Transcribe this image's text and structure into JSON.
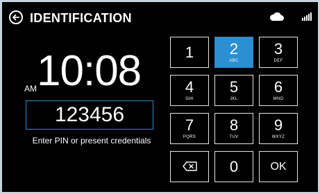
{
  "header": {
    "title": "IDENTIFICATION",
    "back_icon": "back-arrow-circle-icon",
    "status_icons": [
      "cloud-icon",
      "signal-strength-icon"
    ]
  },
  "clock": {
    "time": "10:08",
    "meridiem": "AM"
  },
  "pin": {
    "value": "123456"
  },
  "prompt": "Enter PIN or present credentials",
  "keypad": {
    "keys": [
      {
        "num": "1",
        "sub": ""
      },
      {
        "num": "2",
        "sub": "ABC"
      },
      {
        "num": "3",
        "sub": "DEF"
      },
      {
        "num": "4",
        "sub": "GHI"
      },
      {
        "num": "5",
        "sub": "JKL"
      },
      {
        "num": "6",
        "sub": "MNO"
      },
      {
        "num": "7",
        "sub": "PQRS"
      },
      {
        "num": "8",
        "sub": "TUV"
      },
      {
        "num": "9",
        "sub": "WXYZ"
      }
    ],
    "zero": "0",
    "ok": "OK",
    "backspace_icon": "backspace-icon",
    "active_key": "2"
  },
  "colors": {
    "accent": "#2a8fd3",
    "background": "#000000",
    "frame": "#c9d3dd"
  }
}
